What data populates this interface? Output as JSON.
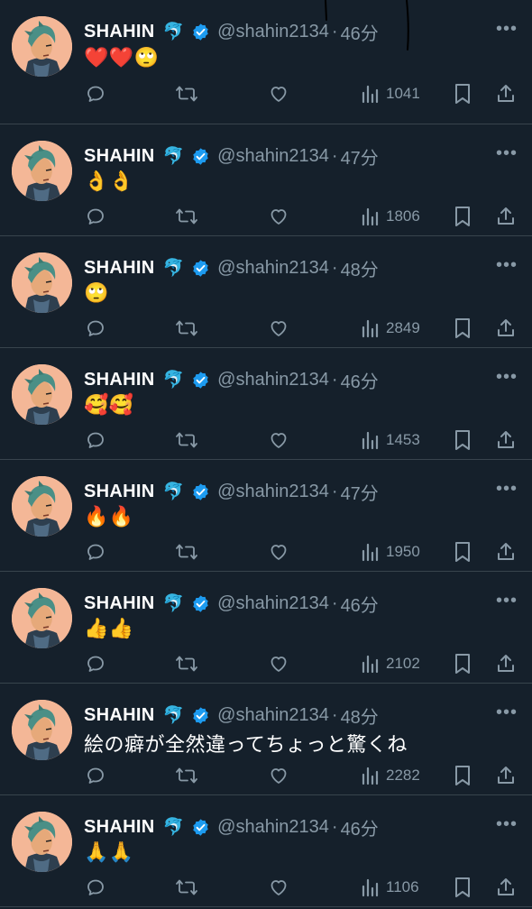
{
  "colors": {
    "background": "#15202b",
    "divider": "#38444d",
    "secondary_text": "#8899a6",
    "verified_badge": "#1d9bf0",
    "avatar_bg": "#f4b797"
  },
  "icons": {
    "reply": "reply-icon",
    "retweet": "retweet-icon",
    "like": "heart-icon",
    "views": "views-chart-icon",
    "bookmark": "bookmark-icon",
    "share": "share-icon",
    "more": "more-options-icon",
    "verified": "verified-badge-icon"
  },
  "tweets": [
    {
      "name": "SHAHIN",
      "badge_emoji": "🐬",
      "handle": "@shahin2134",
      "sep": "·",
      "time": "46分",
      "more": "•••",
      "text": "❤️❤️🙄",
      "views": "1041"
    },
    {
      "name": "SHAHIN",
      "badge_emoji": "🐬",
      "handle": "@shahin2134",
      "sep": "·",
      "time": "47分",
      "more": "•••",
      "text": "👌👌",
      "views": "1806"
    },
    {
      "name": "SHAHIN",
      "badge_emoji": "🐬",
      "handle": "@shahin2134",
      "sep": "·",
      "time": "48分",
      "more": "•••",
      "text": "🙄",
      "views": "2849"
    },
    {
      "name": "SHAHIN",
      "badge_emoji": "🐬",
      "handle": "@shahin2134",
      "sep": "·",
      "time": "46分",
      "more": "•••",
      "text": "🥰🥰",
      "views": "1453"
    },
    {
      "name": "SHAHIN",
      "badge_emoji": "🐬",
      "handle": "@shahin2134",
      "sep": "·",
      "time": "47分",
      "more": "•••",
      "text": "🔥🔥",
      "views": "1950"
    },
    {
      "name": "SHAHIN",
      "badge_emoji": "🐬",
      "handle": "@shahin2134",
      "sep": "·",
      "time": "46分",
      "more": "•••",
      "text": "👍👍",
      "views": "2102"
    },
    {
      "name": "SHAHIN",
      "badge_emoji": "🐬",
      "handle": "@shahin2134",
      "sep": "·",
      "time": "48分",
      "more": "•••",
      "text": "絵の癖が全然違ってちょっと驚くね",
      "views": "2282"
    },
    {
      "name": "SHAHIN",
      "badge_emoji": "🐬",
      "handle": "@shahin2134",
      "sep": "·",
      "time": "46分",
      "more": "•••",
      "text": "🙏🙏",
      "views": "1106"
    }
  ]
}
